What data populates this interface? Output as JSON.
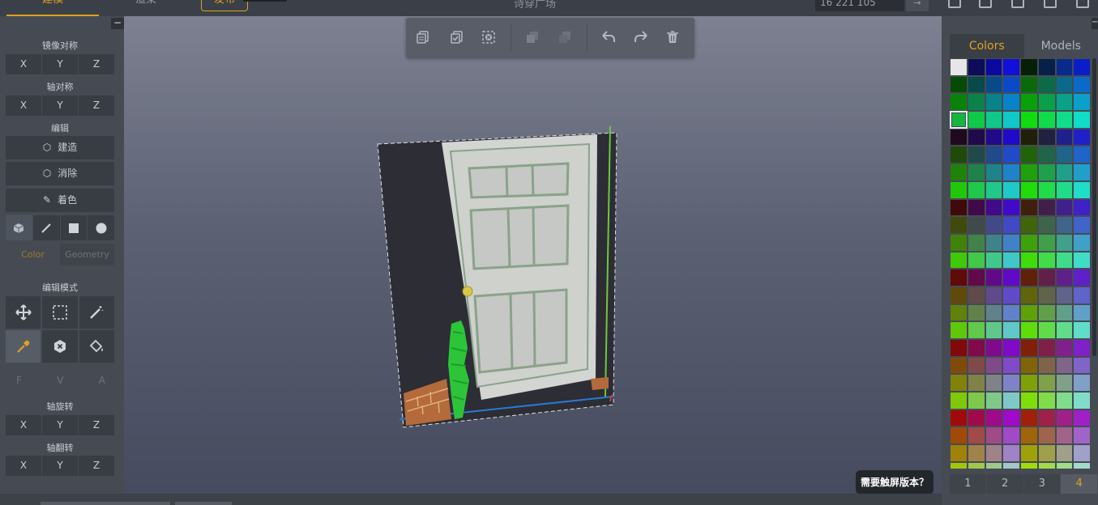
{
  "topbar": {
    "tabs": {
      "build": "建模",
      "render": "渲染",
      "publish": "发布"
    },
    "doc_title": "诗穿广场",
    "color_code": "16 221 105",
    "code_button": "→"
  },
  "left_panel": {
    "collapse": "−",
    "mirror_label": "镜像对称",
    "axis_sym_label": "轴对称",
    "edit_label": "编辑",
    "edit_buttons": {
      "build": "建造",
      "erase": "消除",
      "paint": "着色"
    },
    "subtabs": {
      "color": "Color",
      "geometry": "Geometry"
    },
    "edit_mode_label": "编辑模式",
    "fva": {
      "f": "F",
      "v": "V",
      "a": "A"
    },
    "axis_rot_label": "轴旋转",
    "axis_flip_label": "轴翻转",
    "axes": {
      "x": "X",
      "y": "Y",
      "z": "Z"
    }
  },
  "viewport": {
    "touch_prompt": "需要触屏版本？"
  },
  "right_panel": {
    "tabs": {
      "colors": "Colors",
      "models": "Models"
    },
    "collapse": "−",
    "pages": [
      "1",
      "2",
      "3",
      "4"
    ],
    "active_page": "4",
    "selected_color": "#13b63f"
  },
  "palette_rows": [
    [
      "#e6e6e6",
      "#0c0c5a",
      "#0a0aa0",
      "#1010d8",
      "#062006",
      "#06204a",
      "#0a2a8a",
      "#0a1ec8"
    ],
    [
      "#064a06",
      "#064a4a",
      "#064a8a",
      "#0a4ac8",
      "#0a6a0a",
      "#0a6a4a",
      "#0a6a8a",
      "#0a6ac8"
    ],
    [
      "#0a820a",
      "#0a824a",
      "#0a828a",
      "#0a82c8",
      "#0aa00a",
      "#0aa04a",
      "#0aa08a",
      "#0aa0c8"
    ],
    [
      "#13b63f",
      "#10c84a",
      "#10c88a",
      "#10c8c8",
      "#10dc10",
      "#10dc4a",
      "#10dc8a",
      "#10dcc8"
    ],
    [
      "#200a20",
      "#200a4a",
      "#200a8a",
      "#200ac8",
      "#20200a",
      "#202040",
      "#20208a",
      "#2020c8"
    ],
    [
      "#204a0a",
      "#204a4a",
      "#204a8a",
      "#204ac8",
      "#20640a",
      "#20644a",
      "#20648a",
      "#2064c8"
    ],
    [
      "#20820a",
      "#20824a",
      "#20828a",
      "#2082c8",
      "#20a00a",
      "#20a04a",
      "#20a08a",
      "#20a0c8"
    ],
    [
      "#20c80a",
      "#20c84a",
      "#20c88a",
      "#20c8c8",
      "#20dc0a",
      "#20dc4a",
      "#20dc8a",
      "#20dcc8"
    ],
    [
      "#400a0a",
      "#400a4a",
      "#400a8a",
      "#400ac8",
      "#40200a",
      "#40204a",
      "#40208a",
      "#4020c8"
    ],
    [
      "#404a0a",
      "#404a4a",
      "#404a8a",
      "#404ac8",
      "#40640a",
      "#40644a",
      "#40648a",
      "#4064c8"
    ],
    [
      "#40820a",
      "#40824a",
      "#40828a",
      "#4082c8",
      "#40a00a",
      "#40a04a",
      "#40a08a",
      "#40a0c8"
    ],
    [
      "#40c80a",
      "#40c84a",
      "#40c88a",
      "#40c8c8",
      "#40dc0a",
      "#40dc4a",
      "#40dc8a",
      "#40dcc8"
    ],
    [
      "#600a0a",
      "#600a4a",
      "#600a8a",
      "#600ac8",
      "#60200a",
      "#60204a",
      "#60208a",
      "#6020c8"
    ],
    [
      "#604a0a",
      "#604a4a",
      "#604a8a",
      "#604ac8",
      "#60640a",
      "#60644a",
      "#60648a",
      "#6064c8"
    ],
    [
      "#60820a",
      "#60824a",
      "#60828a",
      "#6082c8",
      "#60a00a",
      "#60a04a",
      "#60a08a",
      "#60a0c8"
    ],
    [
      "#60c80a",
      "#60c84a",
      "#60c88a",
      "#60c8c8",
      "#60dc0a",
      "#60dc4a",
      "#60dc8a",
      "#60dcc8"
    ],
    [
      "#800a0a",
      "#800a4a",
      "#800a8a",
      "#800ac8",
      "#80200a",
      "#80204a",
      "#80208a",
      "#8020c8"
    ],
    [
      "#804a0a",
      "#804a4a",
      "#804a8a",
      "#804ac8",
      "#80640a",
      "#80644a",
      "#80648a",
      "#8064c8"
    ],
    [
      "#80820a",
      "#80824a",
      "#80828a",
      "#8082c8",
      "#80a00a",
      "#80a04a",
      "#80a08a",
      "#80a0c8"
    ],
    [
      "#80c80a",
      "#80c84a",
      "#80c88a",
      "#80c8c8",
      "#80dc0a",
      "#80dc4a",
      "#80dc8a",
      "#80dcc8"
    ],
    [
      "#a00a0a",
      "#a00a4a",
      "#a00a8a",
      "#a00ac8",
      "#a0200a",
      "#a0204a",
      "#a0208a",
      "#a020c8"
    ],
    [
      "#a04a0a",
      "#a04a4a",
      "#a04a8a",
      "#a04ac8",
      "#a0640a",
      "#a0644a",
      "#a0648a",
      "#a064c8"
    ],
    [
      "#a0820a",
      "#a0824a",
      "#a0828a",
      "#a082c8",
      "#a0a00a",
      "#a0a04a",
      "#a0a08a",
      "#a0a0c8"
    ],
    [
      "#a0c80a",
      "#a0c84a",
      "#a0c88a",
      "#a0c8c8",
      "#a0dc0a",
      "#a0dc4a",
      "#a0dc8a",
      "#a0dcc8"
    ]
  ]
}
